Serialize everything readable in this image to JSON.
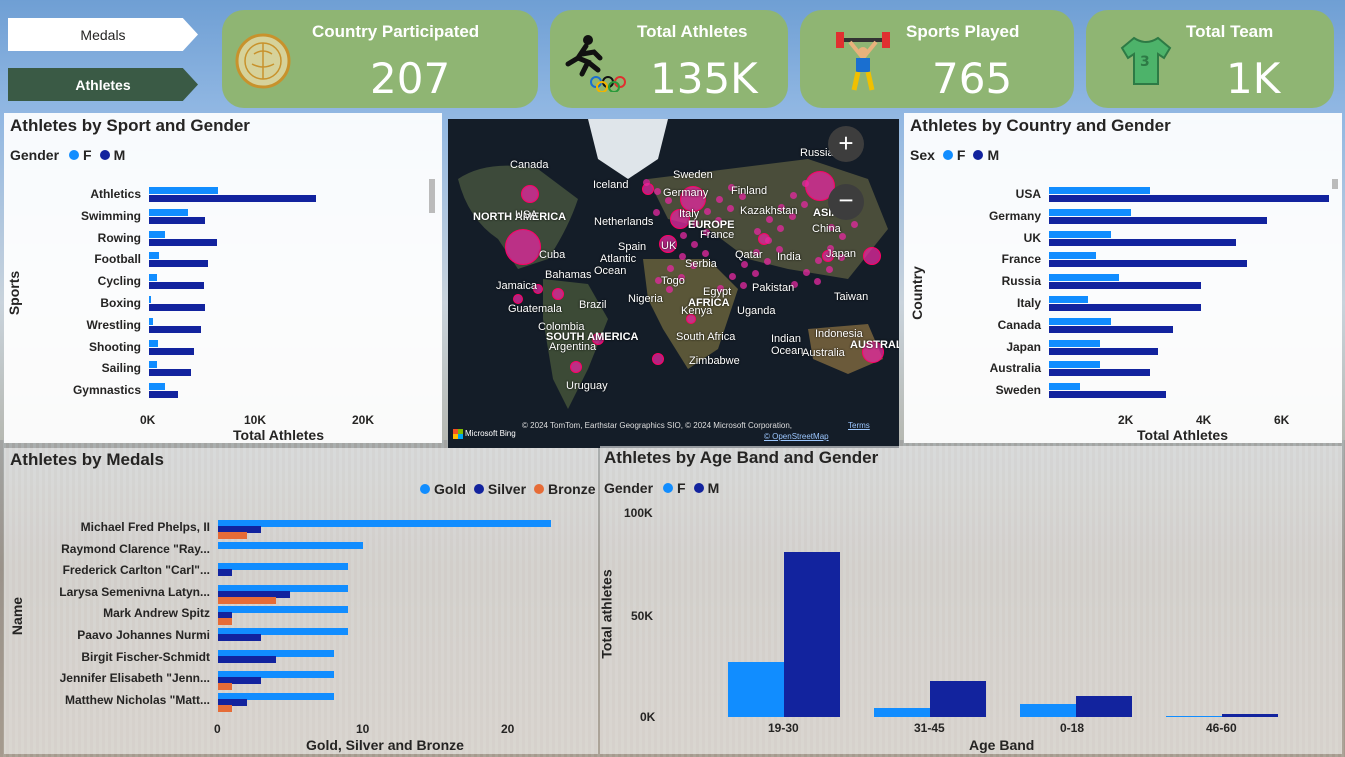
{
  "nav": {
    "medals_label": "Medals",
    "athletes_label": "Athletes"
  },
  "kpis": [
    {
      "label": "Country Participated",
      "value": "207",
      "icon": "globe-icon"
    },
    {
      "label": "Total Athletes",
      "value": "135K",
      "icon": "runner-rings-icon"
    },
    {
      "label": "Sports Played",
      "value": "765",
      "icon": "weightlifter-icon"
    },
    {
      "label": "Total Team",
      "value": "1K",
      "icon": "jersey-icon"
    }
  ],
  "colors": {
    "female": "#118dff",
    "male": "#12239e",
    "gold": "#118dff",
    "silver": "#12239e",
    "bronze": "#e66c37",
    "kpi": "#8fb573"
  },
  "sport_gender": {
    "title": "Athletes by Sport and Gender",
    "legend_title": "Gender",
    "f": "F",
    "m": "M",
    "y_title": "Sports",
    "x_title": "Total Athletes",
    "ticks": [
      "0K",
      "10K",
      "20K"
    ],
    "chart_data": {
      "type": "bar",
      "categories": [
        "Athletics",
        "Swimming",
        "Rowing",
        "Football",
        "Cycling",
        "Boxing",
        "Wrestling",
        "Shooting",
        "Sailing",
        "Gymnastics"
      ],
      "series": [
        {
          "name": "F",
          "values": [
            6400,
            3600,
            1500,
            900,
            700,
            200,
            400,
            800,
            700,
            1500
          ]
        },
        {
          "name": "M",
          "values": [
            15500,
            5200,
            6300,
            5500,
            5100,
            5200,
            4800,
            4200,
            3900,
            2700
          ]
        }
      ],
      "xlim": [
        0,
        26000
      ]
    }
  },
  "country_gender": {
    "title": "Athletes by Country and Gender",
    "legend_title": "Sex",
    "f": "F",
    "m": "M",
    "y_title": "Country",
    "x_title": "Total Athletes",
    "ticks": [
      "2K",
      "4K",
      "6K"
    ],
    "chart_data": {
      "type": "bar",
      "categories": [
        "USA",
        "Germany",
        "UK",
        "France",
        "Russia",
        "Italy",
        "Canada",
        "Japan",
        "Australia",
        "Sweden"
      ],
      "series": [
        {
          "name": "F",
          "values": [
            2600,
            2100,
            1600,
            1200,
            1800,
            1000,
            1600,
            1300,
            1300,
            800
          ]
        },
        {
          "name": "M",
          "values": [
            7200,
            5600,
            4800,
            5100,
            3900,
            3900,
            3200,
            2800,
            2600,
            3000
          ]
        }
      ],
      "xlim": [
        0,
        7300
      ]
    }
  },
  "map": {
    "labels": [
      {
        "t": "Canada",
        "x": 62,
        "y": 40
      },
      {
        "t": "Iceland",
        "x": 145,
        "y": 60
      },
      {
        "t": "Sweden",
        "x": 225,
        "y": 50
      },
      {
        "t": "Russia",
        "x": 352,
        "y": 28
      },
      {
        "t": "Germany",
        "x": 215,
        "y": 68
      },
      {
        "t": "Finland",
        "x": 283,
        "y": 66
      },
      {
        "t": "NORTH AMERICA",
        "x": 25,
        "y": 92,
        "b": true
      },
      {
        "t": "USA",
        "x": 67,
        "y": 90
      },
      {
        "t": "Netherlands",
        "x": 146,
        "y": 97
      },
      {
        "t": "Italy",
        "x": 231,
        "y": 89
      },
      {
        "t": "Kazakhstan",
        "x": 292,
        "y": 86
      },
      {
        "t": "EUROPE",
        "x": 240,
        "y": 100,
        "b": true
      },
      {
        "t": "ASIA",
        "x": 365,
        "y": 88,
        "b": true
      },
      {
        "t": "France",
        "x": 252,
        "y": 110
      },
      {
        "t": "China",
        "x": 364,
        "y": 104
      },
      {
        "t": "Spain",
        "x": 170,
        "y": 122
      },
      {
        "t": "UK",
        "x": 213,
        "y": 121
      },
      {
        "t": "Cuba",
        "x": 91,
        "y": 130
      },
      {
        "t": "Atlantic",
        "x": 152,
        "y": 134
      },
      {
        "t": "Ocean",
        "x": 146,
        "y": 146
      },
      {
        "t": "Qatar",
        "x": 287,
        "y": 130
      },
      {
        "t": "India",
        "x": 329,
        "y": 132
      },
      {
        "t": "Japan",
        "x": 378,
        "y": 129
      },
      {
        "t": "Serbia",
        "x": 237,
        "y": 139
      },
      {
        "t": "Bahamas",
        "x": 97,
        "y": 150
      },
      {
        "t": "Togo",
        "x": 213,
        "y": 156
      },
      {
        "t": "Jamaica",
        "x": 48,
        "y": 161
      },
      {
        "t": "Egypt",
        "x": 255,
        "y": 167
      },
      {
        "t": "Pakistan",
        "x": 304,
        "y": 163
      },
      {
        "t": "AFRICA",
        "x": 240,
        "y": 178,
        "b": true
      },
      {
        "t": "Nigeria",
        "x": 180,
        "y": 174
      },
      {
        "t": "Brazil",
        "x": 131,
        "y": 180
      },
      {
        "t": "Taiwan",
        "x": 386,
        "y": 172
      },
      {
        "t": "Guatemala",
        "x": 60,
        "y": 184
      },
      {
        "t": "Kenya",
        "x": 233,
        "y": 186
      },
      {
        "t": "Uganda",
        "x": 289,
        "y": 186
      },
      {
        "t": "Colombia",
        "x": 90,
        "y": 202
      },
      {
        "t": "SOUTH AMERICA",
        "x": 98,
        "y": 212,
        "b": true
      },
      {
        "t": "South Africa",
        "x": 228,
        "y": 212
      },
      {
        "t": "Indian",
        "x": 323,
        "y": 214
      },
      {
        "t": "Indonesia",
        "x": 367,
        "y": 209
      },
      {
        "t": "Ocean",
        "x": 323,
        "y": 226
      },
      {
        "t": "Argentina",
        "x": 101,
        "y": 222
      },
      {
        "t": "AUSTRALIA",
        "x": 402,
        "y": 220,
        "b": true
      },
      {
        "t": "Australia",
        "x": 354,
        "y": 228
      },
      {
        "t": "Zimbabwe",
        "x": 241,
        "y": 236
      },
      {
        "t": "Uruguay",
        "x": 118,
        "y": 261
      }
    ],
    "provider": "Microsoft Bing",
    "attribution": "© 2024 TomTom, Earthstar Geographics SIO, © 2024 Microsoft Corporation,",
    "terms": "Terms",
    "osm": "© OpenStreetMap"
  },
  "medals": {
    "title": "Athletes by Medals",
    "gold": "Gold",
    "silver": "Silver",
    "bronze": "Bronze",
    "y_title": "Name",
    "x_title": "Gold, Silver and Bronze",
    "ticks": [
      "0",
      "10",
      "20"
    ],
    "chart_data": {
      "type": "bar",
      "categories": [
        "Michael Fred Phelps, II",
        "Raymond Clarence \"Ray...",
        "Frederick Carlton \"Carl\"...",
        "Larysa Semenivna Latyn...",
        "Mark Andrew Spitz",
        "Paavo Johannes Nurmi",
        "Birgit Fischer-Schmidt",
        "Jennifer Elisabeth \"Jenn...",
        "Matthew Nicholas \"Matt..."
      ],
      "series": [
        {
          "name": "Gold",
          "values": [
            23,
            10,
            9,
            9,
            9,
            9,
            8,
            8,
            8
          ]
        },
        {
          "name": "Silver",
          "values": [
            3,
            0,
            1,
            5,
            1,
            3,
            4,
            3,
            2
          ]
        },
        {
          "name": "Bronze",
          "values": [
            2,
            0,
            0,
            4,
            1,
            0,
            0,
            1,
            1
          ]
        }
      ],
      "xlim": [
        0,
        26
      ]
    }
  },
  "age": {
    "title": "Athletes by Age Band and Gender",
    "legend_title": "Gender",
    "f": "F",
    "m": "M",
    "y_title": "Total athletes",
    "x_title": "Age Band",
    "yticks": [
      "100K",
      "50K",
      "0K"
    ],
    "chart_data": {
      "type": "bar",
      "categories": [
        "19-30",
        "31-45",
        "0-18",
        "46-60"
      ],
      "series": [
        {
          "name": "F",
          "values": [
            27000,
            4500,
            6500,
            400
          ]
        },
        {
          "name": "M",
          "values": [
            81000,
            17500,
            10500,
            1500
          ]
        }
      ],
      "ylim": [
        0,
        100000
      ]
    }
  }
}
